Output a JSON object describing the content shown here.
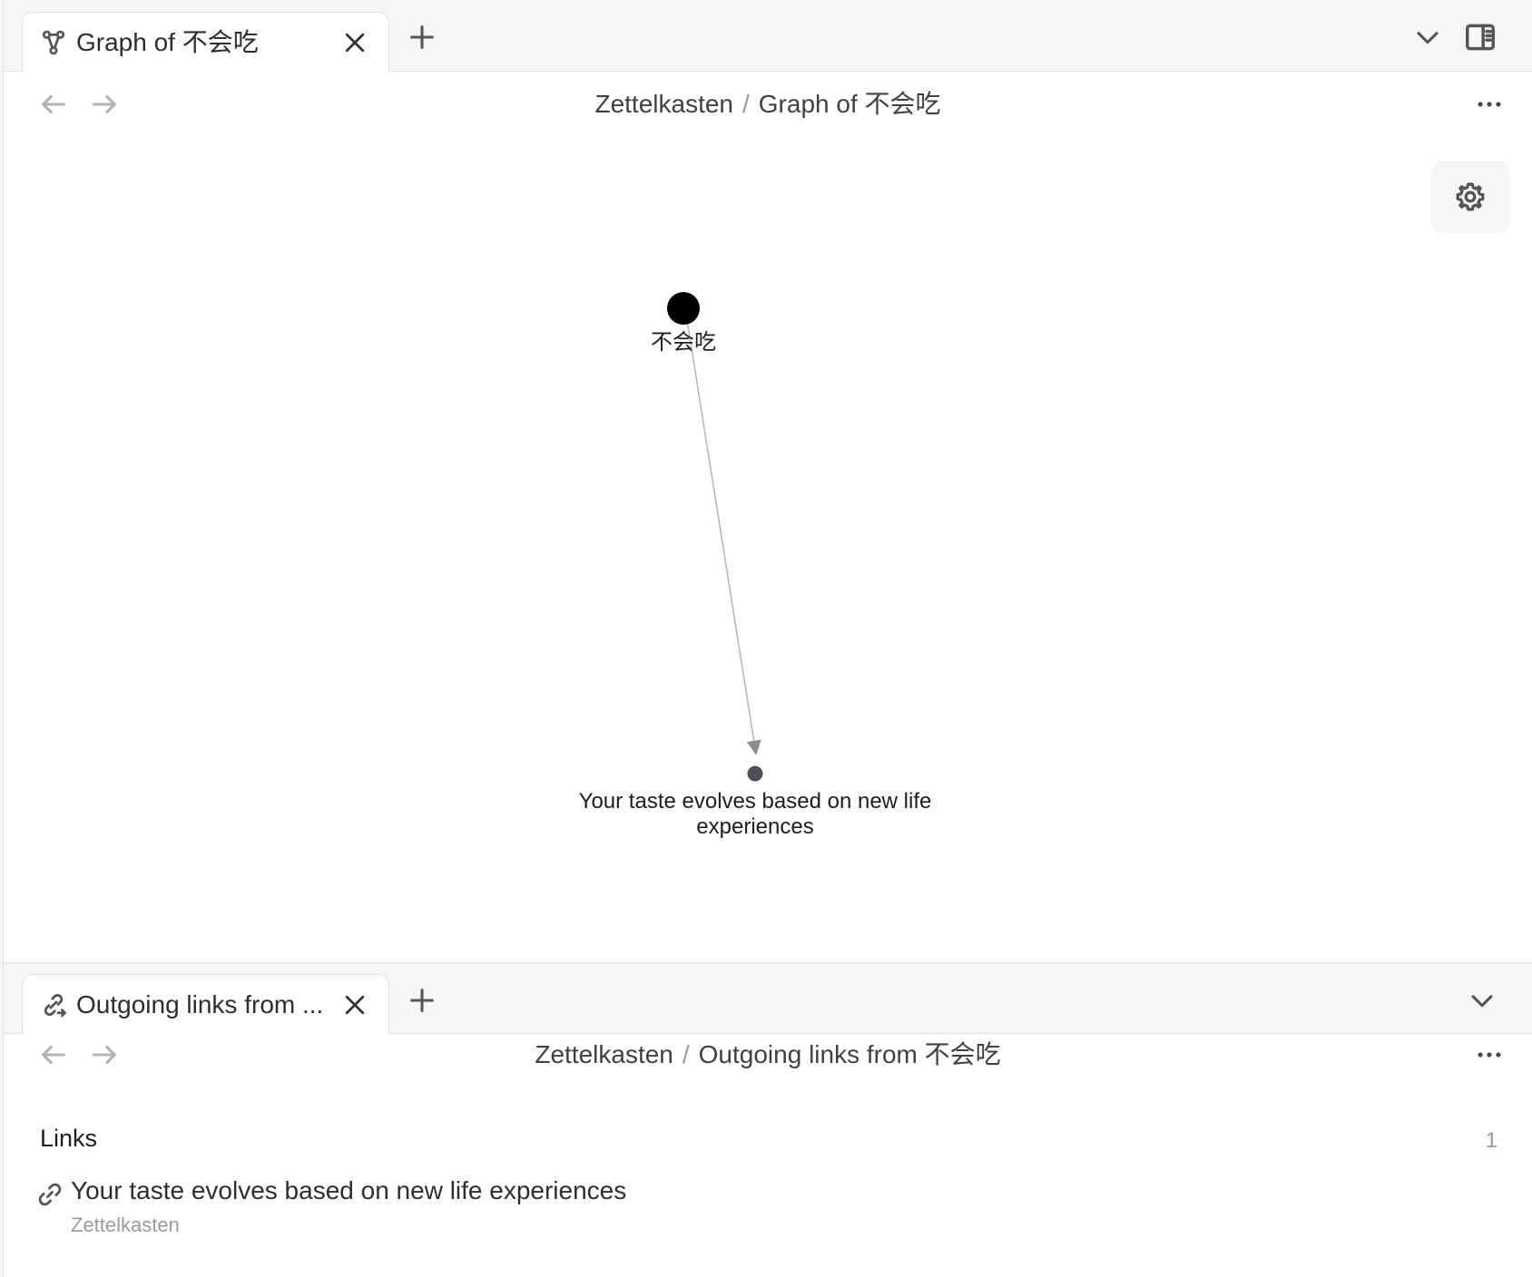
{
  "top_pane": {
    "tab": {
      "title": "Graph of 不会吃",
      "icon": "graph-icon"
    },
    "breadcrumb": {
      "vault": "Zettelkasten",
      "separator": "/",
      "page": "Graph of 不会吃"
    },
    "graph": {
      "nodes": [
        {
          "id": "source",
          "label": "不会吃"
        },
        {
          "id": "target",
          "label_line1": "Your taste evolves based on new life",
          "label_line2": "experiences"
        }
      ],
      "edge": {
        "from": "source",
        "to": "target",
        "directed": true
      },
      "colors": {
        "source_node": "#000000",
        "target_node": "#4a4f5a",
        "edge": "#b8b8b8"
      }
    }
  },
  "bottom_pane": {
    "tab": {
      "title": "Outgoing links from ...",
      "icon": "outgoing-links-icon"
    },
    "breadcrumb": {
      "vault": "Zettelkasten",
      "separator": "/",
      "page": "Outgoing links from 不会吃"
    },
    "links": {
      "heading": "Links",
      "count": "1",
      "items": [
        {
          "title": "Your taste evolves based on new life experiences",
          "folder": "Zettelkasten",
          "icon": "link-icon"
        }
      ]
    }
  },
  "colors": {
    "chrome_bg": "#f6f6f7",
    "content_bg": "#ffffff",
    "text": "#2e2e2e",
    "muted": "#9a9a9a"
  }
}
